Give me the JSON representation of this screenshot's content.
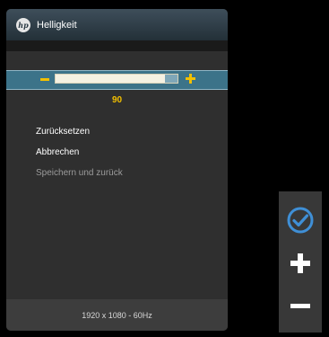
{
  "osd": {
    "title": "Helligkeit",
    "brightness": {
      "value_label": "90",
      "value": 90,
      "max": 100
    },
    "menu": [
      {
        "label": "Zurücksetzen",
        "enabled": true
      },
      {
        "label": "Abbrechen",
        "enabled": true
      },
      {
        "label": "Speichern und zurück",
        "enabled": false
      }
    ],
    "footer": "1920 x 1080 - 60Hz"
  },
  "colors": {
    "accent": "#f3c000",
    "slider_band": "#3c7389",
    "panel_bg": "#2f2f2f",
    "check_icon": "#3f8fd6"
  },
  "buttons": {
    "icons": [
      "check-circle-icon",
      "plus-icon",
      "minus-icon"
    ]
  }
}
